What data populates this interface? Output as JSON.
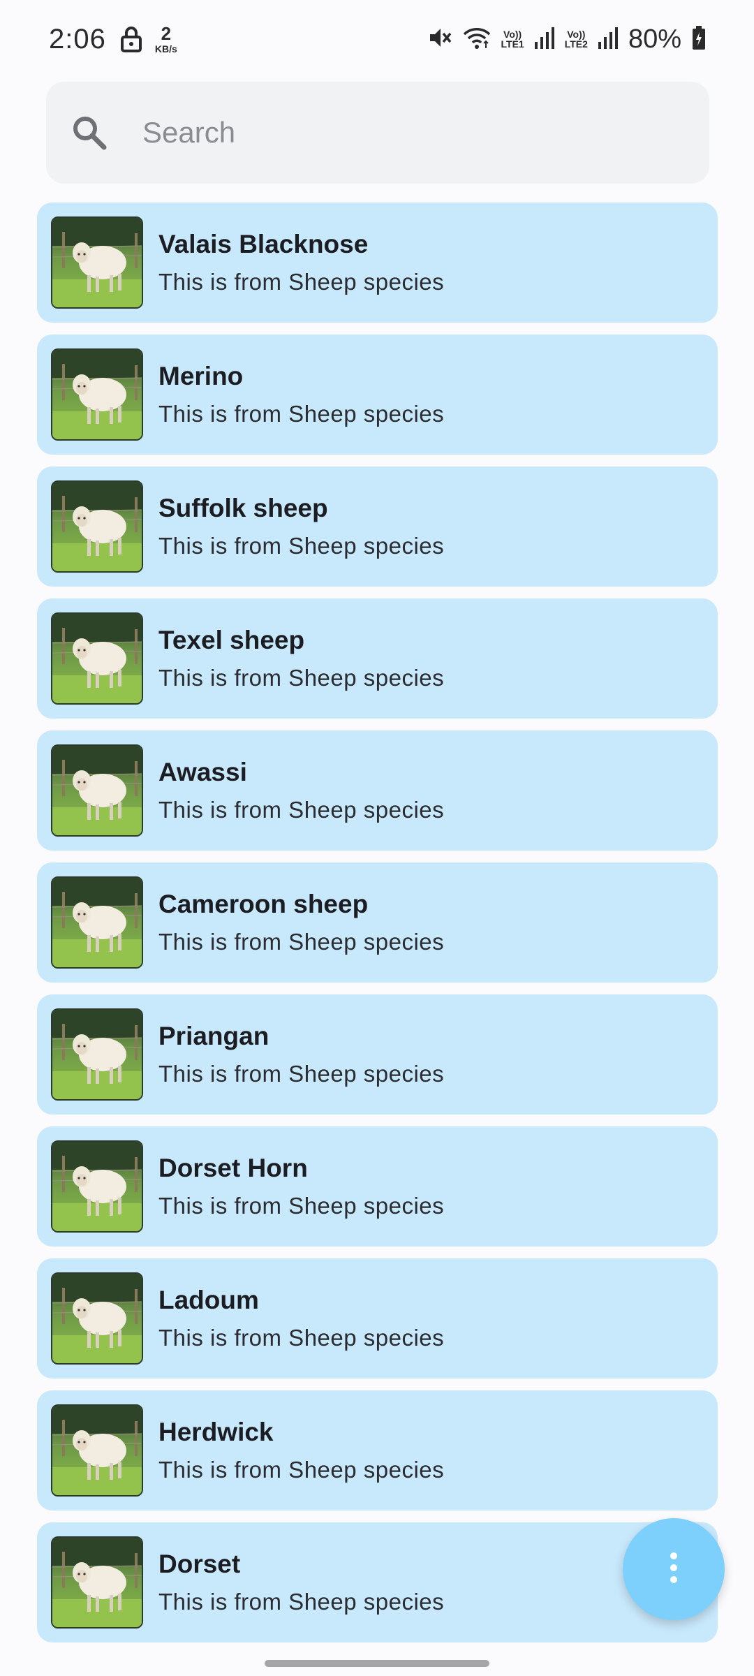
{
  "status_bar": {
    "time": "2:06",
    "net_speed_value": "2",
    "net_speed_unit": "KB/s",
    "sim1_top": "Vo))",
    "sim1_bottom": "LTE1",
    "sim2_top": "Vo))",
    "sim2_bottom": "LTE2",
    "battery": "80%"
  },
  "search": {
    "placeholder": "Search"
  },
  "items": [
    {
      "title": "Valais Blacknose",
      "subtitle": "This is from Sheep species"
    },
    {
      "title": "Merino",
      "subtitle": "This is from Sheep species"
    },
    {
      "title": "Suffolk sheep",
      "subtitle": "This is from Sheep species"
    },
    {
      "title": "Texel sheep",
      "subtitle": "This is from Sheep species"
    },
    {
      "title": "Awassi",
      "subtitle": "This is from Sheep species"
    },
    {
      "title": "Cameroon sheep",
      "subtitle": "This is from Sheep species"
    },
    {
      "title": "Priangan",
      "subtitle": "This is from Sheep species"
    },
    {
      "title": "Dorset Horn",
      "subtitle": "This is from Sheep species"
    },
    {
      "title": "Ladoum",
      "subtitle": "This is from Sheep species"
    },
    {
      "title": "Herdwick",
      "subtitle": "This is from Sheep species"
    },
    {
      "title": "Dorset",
      "subtitle": "This is from Sheep species"
    }
  ],
  "icons": {
    "search": "search-icon",
    "fab": "more-vert-icon",
    "thumbnail": "sheep-photo"
  },
  "colors": {
    "card_bg": "#c8e8fb",
    "fab_bg": "#7cd0fb",
    "search_bg": "#f1f2f4"
  }
}
